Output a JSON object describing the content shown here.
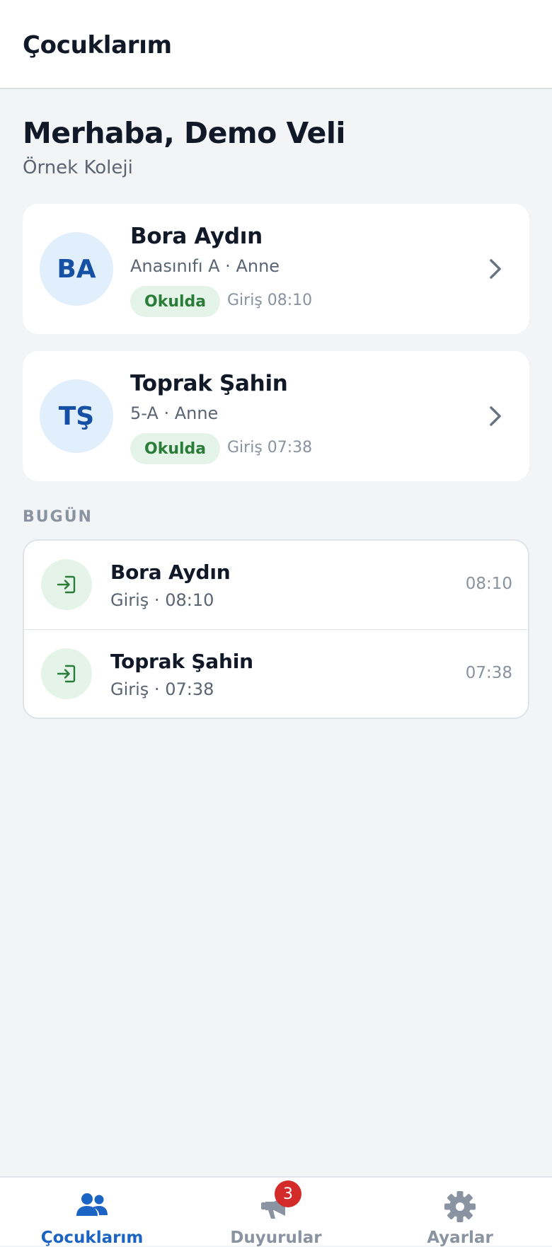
{
  "header": {
    "title": "Çocuklarım"
  },
  "greeting": {
    "title": "Merhaba, Demo Veli",
    "school": "Örnek Koleji"
  },
  "children": [
    {
      "initials": "BA",
      "name": "Bora Aydın",
      "meta": "Anasınıfı A · Anne",
      "status": "Okulda",
      "checkin": "Giriş 08:10"
    },
    {
      "initials": "TŞ",
      "name": "Toprak Şahin",
      "meta": "5-A · Anne",
      "status": "Okulda",
      "checkin": "Giriş 07:38"
    }
  ],
  "today": {
    "label": "BUGÜN",
    "events": [
      {
        "name": "Bora Aydın",
        "detail": "Giriş · 08:10",
        "time": "08:10",
        "icon": "login-icon"
      },
      {
        "name": "Toprak Şahin",
        "detail": "Giriş · 07:38",
        "time": "07:38",
        "icon": "login-icon"
      }
    ]
  },
  "nav": {
    "items": [
      {
        "label": "Çocuklarım",
        "icon": "users-icon",
        "active": true
      },
      {
        "label": "Duyurular",
        "icon": "megaphone-icon",
        "badge": "3"
      },
      {
        "label": "Ayarlar",
        "icon": "gear-icon"
      }
    ]
  },
  "colors": {
    "accent": "#1c64c4",
    "status_green": "#2a7d38",
    "badge_red": "#d32a2a"
  }
}
